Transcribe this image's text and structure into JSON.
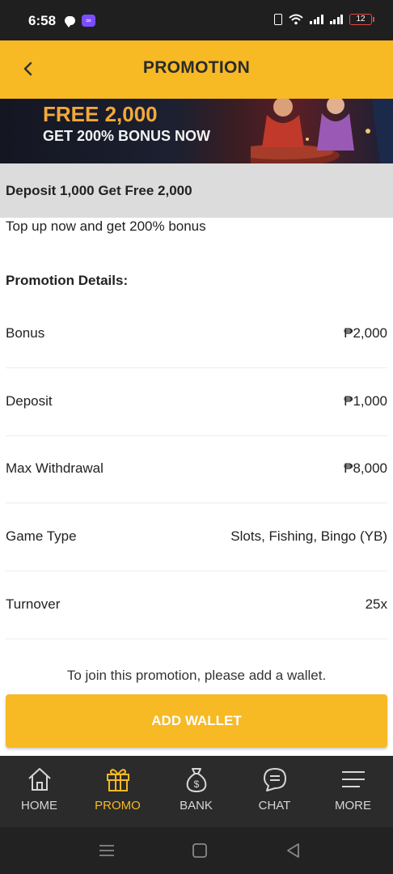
{
  "status_bar": {
    "time": "6:58",
    "battery": "12",
    "app_badge": "∞"
  },
  "header": {
    "title": "PROMOTION"
  },
  "banner": {
    "line1": "FREE 2,000",
    "line2": "GET 200% BONUS NOW"
  },
  "promotion": {
    "name": "Deposit 1,000 Get Free 2,000",
    "subtitle": "Top up now and get 200% bonus",
    "details_heading": "Promotion Details:",
    "details": [
      {
        "label": "Bonus",
        "value": "₱2,000"
      },
      {
        "label": "Deposit",
        "value": "₱1,000"
      },
      {
        "label": "Max Withdrawal",
        "value": "₱8,000"
      },
      {
        "label": "Game Type",
        "value": "Slots, Fishing, Bingo (YB)"
      },
      {
        "label": "Turnover",
        "value": "25x"
      }
    ],
    "join_text": "To join this promotion, please add a wallet.",
    "cta_label": "ADD WALLET"
  },
  "bottom_nav": {
    "active": "PROMO",
    "items": [
      {
        "label": "HOME",
        "icon": "home-icon"
      },
      {
        "label": "PROMO",
        "icon": "gift-icon"
      },
      {
        "label": "BANK",
        "icon": "money-bag-icon"
      },
      {
        "label": "CHAT",
        "icon": "chat-icon"
      },
      {
        "label": "MORE",
        "icon": "menu-icon"
      }
    ]
  },
  "colors": {
    "accent": "#f7b924",
    "nav_bg": "#2b2b2b",
    "name_bar_bg": "#dcdcdc"
  }
}
